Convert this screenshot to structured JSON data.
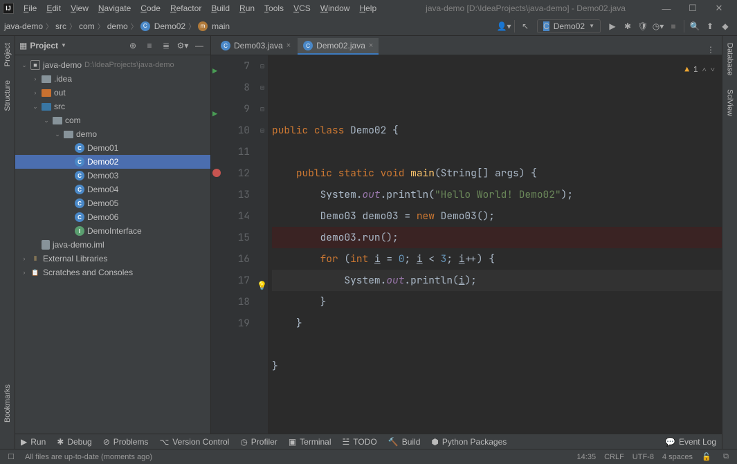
{
  "title": "java-demo [D:\\IdeaProjects\\java-demo] - Demo02.java",
  "menu": [
    "File",
    "Edit",
    "View",
    "Navigate",
    "Code",
    "Refactor",
    "Build",
    "Run",
    "Tools",
    "VCS",
    "Window",
    "Help"
  ],
  "breadcrumb": [
    "java-demo",
    "src",
    "com",
    "demo",
    "Demo02",
    "main"
  ],
  "run_config_label": "Demo02",
  "left_strip": {
    "project": "Project",
    "structure": "Structure",
    "bookmarks": "Bookmarks"
  },
  "right_strip": {
    "database": "Database",
    "sciview": "SciView"
  },
  "tree_header": "Project",
  "tree": [
    {
      "ind": 0,
      "exp": "v",
      "icon": "module",
      "label": "java-demo",
      "path": "D:\\IdeaProjects\\java-demo"
    },
    {
      "ind": 1,
      "exp": ">",
      "icon": "folder",
      "label": ".idea"
    },
    {
      "ind": 1,
      "exp": ">",
      "icon": "folder-out",
      "label": "out"
    },
    {
      "ind": 1,
      "exp": "v",
      "icon": "folder-src",
      "label": "src"
    },
    {
      "ind": 2,
      "exp": "v",
      "icon": "folder",
      "label": "com"
    },
    {
      "ind": 3,
      "exp": "v",
      "icon": "folder",
      "label": "demo"
    },
    {
      "ind": 4,
      "exp": "",
      "icon": "class",
      "label": "Demo01"
    },
    {
      "ind": 4,
      "exp": "",
      "icon": "class",
      "label": "Demo02",
      "selected": true
    },
    {
      "ind": 4,
      "exp": "",
      "icon": "class",
      "label": "Demo03"
    },
    {
      "ind": 4,
      "exp": "",
      "icon": "class",
      "label": "Demo04"
    },
    {
      "ind": 4,
      "exp": "",
      "icon": "class",
      "label": "Demo05"
    },
    {
      "ind": 4,
      "exp": "",
      "icon": "class",
      "label": "Demo06"
    },
    {
      "ind": 4,
      "exp": "",
      "icon": "iface",
      "label": "DemoInterface"
    },
    {
      "ind": 1,
      "exp": "",
      "icon": "file",
      "label": "java-demo.iml"
    },
    {
      "ind": 0,
      "exp": ">",
      "icon": "lib",
      "label": "External Libraries"
    },
    {
      "ind": 0,
      "exp": ">",
      "icon": "scratch",
      "label": "Scratches and Consoles"
    }
  ],
  "tabs": [
    {
      "label": "Demo03.java",
      "active": false
    },
    {
      "label": "Demo02.java",
      "active": true
    }
  ],
  "line_start": 7,
  "line_end": 19,
  "warn_count": "1",
  "code_lines": [
    {
      "n": 7,
      "run": true,
      "html": "<span class='k'>public class</span> <span class='ident'>Demo02 {</span>"
    },
    {
      "n": 8,
      "html": ""
    },
    {
      "n": 9,
      "run": true,
      "fold": "⊟",
      "html": "    <span class='k'>public static</span> <span class='k'>void</span> <span class='fn'>main</span><span class='ident'>(String[] args) {</span>"
    },
    {
      "n": 10,
      "html": "        <span class='ident'>System.</span><span class='fld'>out</span><span class='ident'>.println(</span><span class='s'>\"Hello World! Demo02\"</span><span class='ident'>);</span>"
    },
    {
      "n": 11,
      "html": "        <span class='ident'>Demo03 demo03 = </span><span class='k'>new</span> <span class='ident'>Demo03();</span>"
    },
    {
      "n": 12,
      "bp": true,
      "html": "        <span class='ident'>demo03.run();</span>"
    },
    {
      "n": 13,
      "fold": "⊟",
      "html": "        <span class='k'>for</span> <span class='ident'>(</span><span class='k'>int</span> <span class='ident'><u>i</u> = </span><span class='n'>0</span><span class='ident'>; <u>i</u> &lt; </span><span class='n'>3</span><span class='ident'>; <u>i</u>++) {</span>"
    },
    {
      "n": 14,
      "cur": true,
      "bulb": true,
      "html": "            <span class='ident'>System.</span><span class='fld'>out</span><span class='ident'>.println(<u>i</u>);</span>"
    },
    {
      "n": 15,
      "fold": "⊟",
      "html": "        <span class='ident'>}</span>"
    },
    {
      "n": 16,
      "fold": "⊟",
      "html": "    <span class='ident'>}</span>"
    },
    {
      "n": 17,
      "html": ""
    },
    {
      "n": 18,
      "html": "<span class='ident'>}</span>"
    },
    {
      "n": 19,
      "html": ""
    }
  ],
  "bottom_tools": [
    {
      "icon": "▶",
      "label": "Run"
    },
    {
      "icon": "✱",
      "label": "Debug"
    },
    {
      "icon": "⊘",
      "label": "Problems"
    },
    {
      "icon": "⌥",
      "label": "Version Control"
    },
    {
      "icon": "◷",
      "label": "Profiler"
    },
    {
      "icon": "▣",
      "label": "Terminal"
    },
    {
      "icon": "☱",
      "label": "TODO"
    },
    {
      "icon": "🔨",
      "label": "Build"
    },
    {
      "icon": "⬢",
      "label": "Python Packages"
    }
  ],
  "event_log": "Event Log",
  "status": {
    "msg": "All files are up-to-date (moments ago)",
    "pos": "14:35",
    "sep": "CRLF",
    "enc": "UTF-8",
    "indent": "4 spaces"
  }
}
